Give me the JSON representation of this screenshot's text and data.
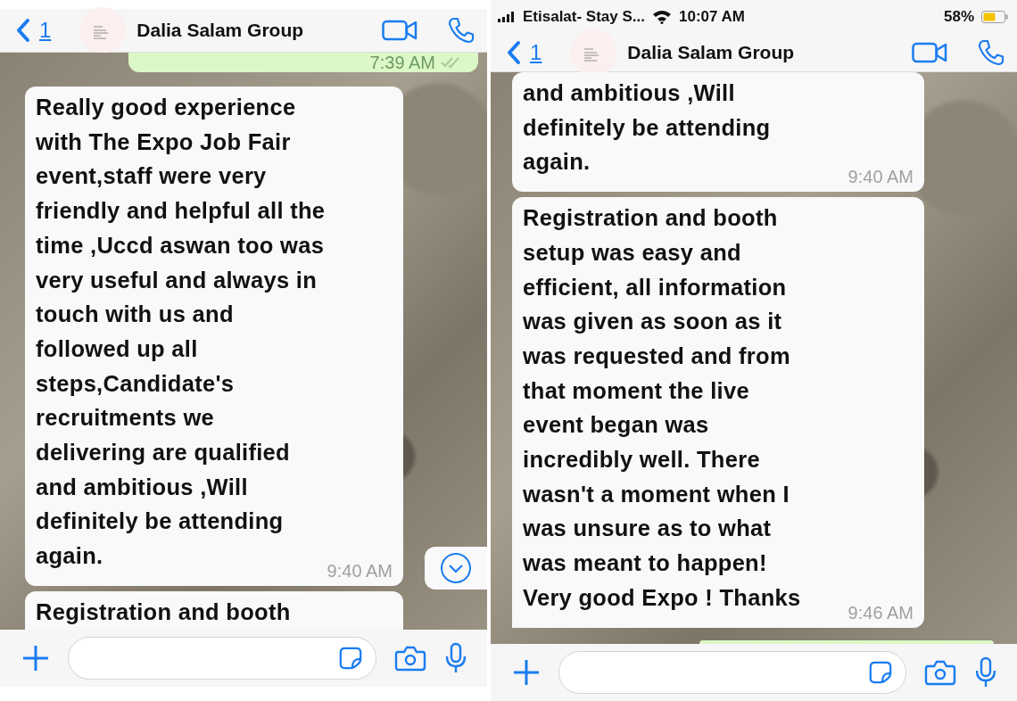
{
  "panels": [
    {
      "header": {
        "back_count": "1",
        "title": "Dalia Salam Group"
      },
      "messages": [
        {
          "kind": "outgoing",
          "time": "7:39 AM",
          "read": true
        },
        {
          "kind": "incoming",
          "lines": [
            "Really good experience",
            "with The Expo Job Fair",
            "event,staff were very",
            "friendly and helpful all the",
            "time ,Uccd aswan too was",
            "very useful and always in",
            "touch with us and",
            "followed up all",
            "steps,Candidate's",
            "recruitments we",
            "delivering are qualified",
            "and ambitious ,Will",
            "definitely be attending",
            "again."
          ],
          "time": "9:40 AM"
        },
        {
          "kind": "incoming",
          "lines": [
            "Registration and booth"
          ]
        }
      ],
      "scroll_down": true
    },
    {
      "status_bar": {
        "carrier": "Etisalat- Stay S...",
        "time": "10:07 AM",
        "battery": "58%"
      },
      "header": {
        "back_count": "1",
        "title": "Dalia Salam Group"
      },
      "messages": [
        {
          "kind": "incoming",
          "lines": [
            "and ambitious ,Will",
            "definitely be attending",
            "again."
          ],
          "time": "9:40 AM"
        },
        {
          "kind": "incoming",
          "lines": [
            "Registration and booth",
            "setup was easy and",
            "efficient, all information",
            "was given as soon as it",
            "was requested and from",
            "that moment the live",
            "event began was",
            "incredibly well. There",
            "wasn't a moment when I",
            "was unsure as to what",
            "was meant to happen!",
            "Very good Expo ! Thanks"
          ],
          "time": "9:46 AM",
          "tail": true
        },
        {
          "kind": "outgoing"
        }
      ]
    }
  ]
}
